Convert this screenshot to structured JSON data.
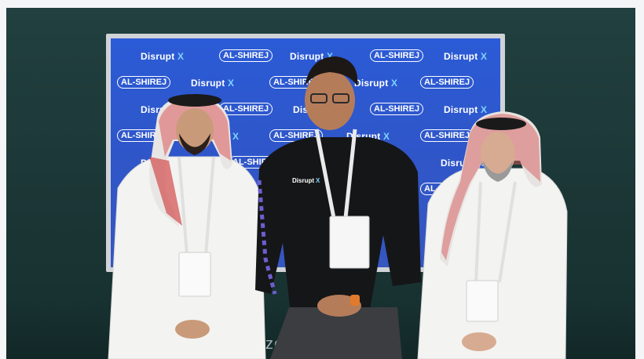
{
  "screen": {
    "logo_disrupt": "Disrupt",
    "logo_x": "X",
    "logo_alshirej": "AL-SHIREJ"
  },
  "shirt": {
    "brand": "Disrupt",
    "brand_x": "X"
  },
  "backdrop_text": "ze       ghts"
}
